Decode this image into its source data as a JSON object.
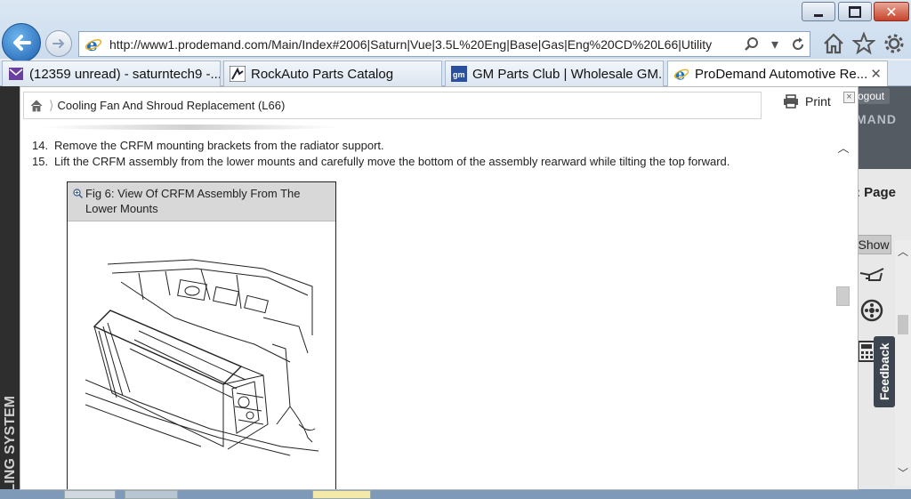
{
  "browser": {
    "address": "http://www1.prodemand.com/Main/Index#2006|Saturn|Vue|3.5L%20Eng|Base|Gas|Eng%20CD%20L66|Utility",
    "tabs": [
      {
        "label": "(12359 unread) - saturntech9 -...",
        "icon": "mail-icon"
      },
      {
        "label": "RockAuto Parts Catalog",
        "icon": "rockauto-icon"
      },
      {
        "label": "GM Parts Club | Wholesale GM...",
        "icon": "gm-icon"
      },
      {
        "label": "ProDemand Automotive Re...",
        "icon": "ie-icon",
        "active": true
      }
    ]
  },
  "dialog": {
    "breadcrumb": "Cooling Fan And Shroud Replacement (L66)",
    "print_label": "Print",
    "close_label": "×",
    "steps": [
      {
        "num": "14.",
        "text": "Remove the CRFM mounting brackets from the radiator support."
      },
      {
        "num": "15.",
        "text": "Lift the CRFM assembly from the lower mounts and carefully move the bottom of the assembly rearward while tilting the top forward."
      }
    ],
    "figure": {
      "caption_line1": "Fig 6: View Of CRFM Assembly From The",
      "caption_line2": "Lower Mounts"
    }
  },
  "app": {
    "logout": "ogout",
    "brand": "MAND",
    "page_label": ": Page",
    "show_label": "Show",
    "feedback_label": "Feedback",
    "left_label": "LING SYSTEM"
  }
}
